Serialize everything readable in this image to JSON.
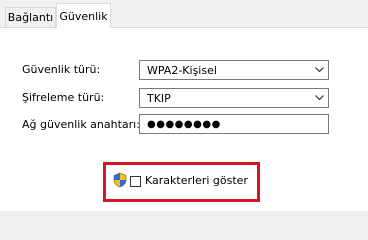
{
  "tabs": [
    {
      "label": "Bağlantı",
      "active": false
    },
    {
      "label": "Güvenlik",
      "active": true
    }
  ],
  "form": {
    "security_type": {
      "label": "Güvenlik türü:",
      "value": "WPA2-Kişisel"
    },
    "encryption_type": {
      "label": "Şifreleme türü:",
      "value": "TKIP"
    },
    "network_key": {
      "label": "Ağ güvenlik anahtarı:",
      "value": "●●●●●●●●"
    },
    "show_characters": {
      "label": "Karakterleri göster",
      "checked": false
    }
  },
  "icons": {
    "dropdown": "chevron-down-icon",
    "uac": "uac-shield-icon"
  },
  "colors": {
    "highlight": "#d7171f",
    "panel": "#ffffff",
    "background": "#f0f0f0"
  }
}
